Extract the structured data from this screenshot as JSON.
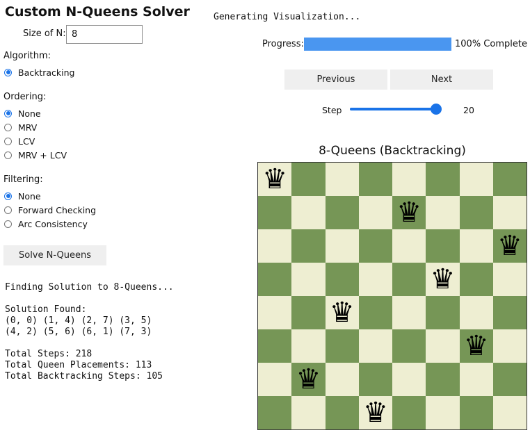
{
  "app": {
    "title": "Custom N-Queens Solver"
  },
  "size": {
    "label": "Size of N:",
    "value": "8"
  },
  "algorithm": {
    "label": "Algorithm:",
    "options": [
      {
        "label": "Backtracking",
        "checked": true
      }
    ]
  },
  "ordering": {
    "label": "Ordering:",
    "options": [
      {
        "label": "None",
        "checked": true
      },
      {
        "label": "MRV",
        "checked": false
      },
      {
        "label": "LCV",
        "checked": false
      },
      {
        "label": "MRV + LCV",
        "checked": false
      }
    ]
  },
  "filtering": {
    "label": "Filtering:",
    "options": [
      {
        "label": "None",
        "checked": true
      },
      {
        "label": "Forward Checking",
        "checked": false
      },
      {
        "label": "Arc Consistency",
        "checked": false
      }
    ]
  },
  "solve_button": {
    "label": "Solve N-Queens"
  },
  "visualization": {
    "status": "Generating Visualization...",
    "progress_label": "Progress:",
    "progress_fraction": 1.0,
    "progress_text": "100% Complete",
    "previous_label": "Previous",
    "next_label": "Next",
    "step_label": "Step",
    "step_value": "20",
    "step_fraction": 0.95
  },
  "board": {
    "title": "8-Queens (Backtracking)",
    "n": 8,
    "queen_icon": "queen-icon",
    "queen_glyph": "♛",
    "queens": [
      [
        0,
        0
      ],
      [
        1,
        4
      ],
      [
        2,
        7
      ],
      [
        3,
        5
      ],
      [
        4,
        2
      ],
      [
        5,
        6
      ],
      [
        6,
        1
      ],
      [
        7,
        3
      ]
    ],
    "colors": {
      "light": "#eeeed2",
      "dark": "#769656"
    }
  },
  "log": {
    "line1": "Finding Solution to 8-Queens...",
    "line2": "Solution Found:",
    "line3": "(0, 0) (1, 4) (2, 7) (3, 5)",
    "line4": "(4, 2) (5, 6) (6, 1) (7, 3)",
    "line5": "Total Steps: 218",
    "line6": "Total Queen Placements: 113",
    "line7": "Total Backtracking Steps: 105"
  },
  "colors": {
    "accent": "#1a73e8",
    "progress": "#4a96f0"
  }
}
